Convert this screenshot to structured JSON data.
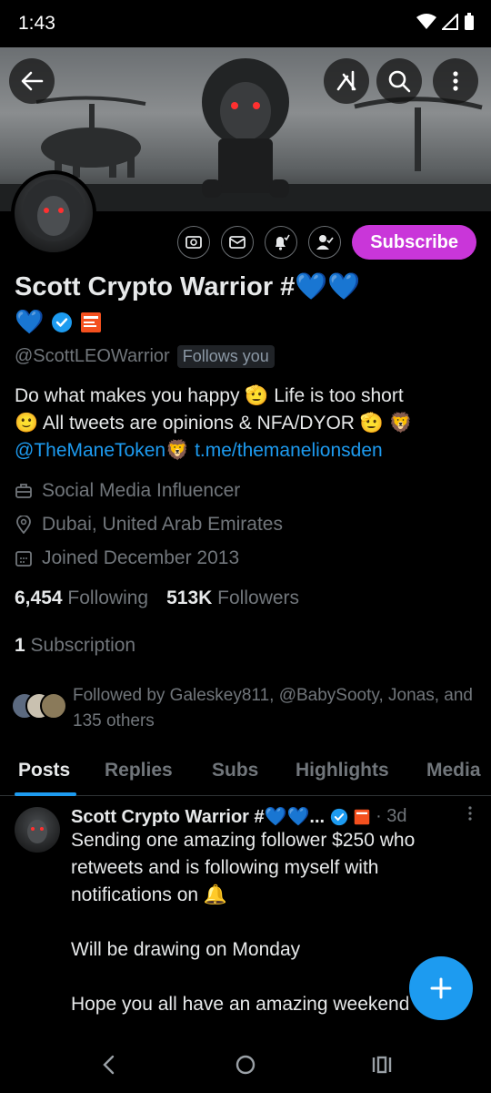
{
  "status": {
    "time": "1:43"
  },
  "header": {
    "back_icon": "back-arrow-icon",
    "grok_icon": "grok-icon",
    "search_icon": "search-icon",
    "more_icon": "more-vertical-icon"
  },
  "profile": {
    "name": "Scott Crypto Warrior #💙💙",
    "name_line2": "💙",
    "handle": "@ScottLEOWarrior",
    "follows_you": "Follows you",
    "subscribe_label": "Subscribe",
    "bio": {
      "line1": "Do what makes you happy 🫡  Life is too short",
      "line2": "🙂  All tweets are opinions & NFA/DYOR 🫡  🦁",
      "mention": "@TheManeToken",
      "mention_suffix": "🦁 ",
      "link": "t.me/themanelionsden"
    },
    "category": "Social Media Influencer",
    "location": "Dubai, United Arab Emirates",
    "joined": "Joined December 2013",
    "following_count": "6,454",
    "following_label": "Following",
    "followers_count": "513K",
    "followers_label": "Followers",
    "subscription_count": "1",
    "subscription_label": "Subscription",
    "followed_by": "Followed by Galeskey811, @BabySooty, Jonas, and 135 others"
  },
  "tabs": [
    {
      "label": "Posts"
    },
    {
      "label": "Replies"
    },
    {
      "label": "Subs"
    },
    {
      "label": "Highlights"
    },
    {
      "label": "Media"
    }
  ],
  "post": {
    "author": "Scott Crypto Warrior #💙💙...",
    "time": "· 3d",
    "line1": "Sending one amazing follower $250 who retweets and is following myself with notifications on 🔔",
    "line2": "Will be drawing on Monday",
    "line3": "Hope you all have an amazing weekend"
  },
  "colors": {
    "accent": "#1d9bf0",
    "subscribe": "#c936d9",
    "muted": "#71767b"
  }
}
